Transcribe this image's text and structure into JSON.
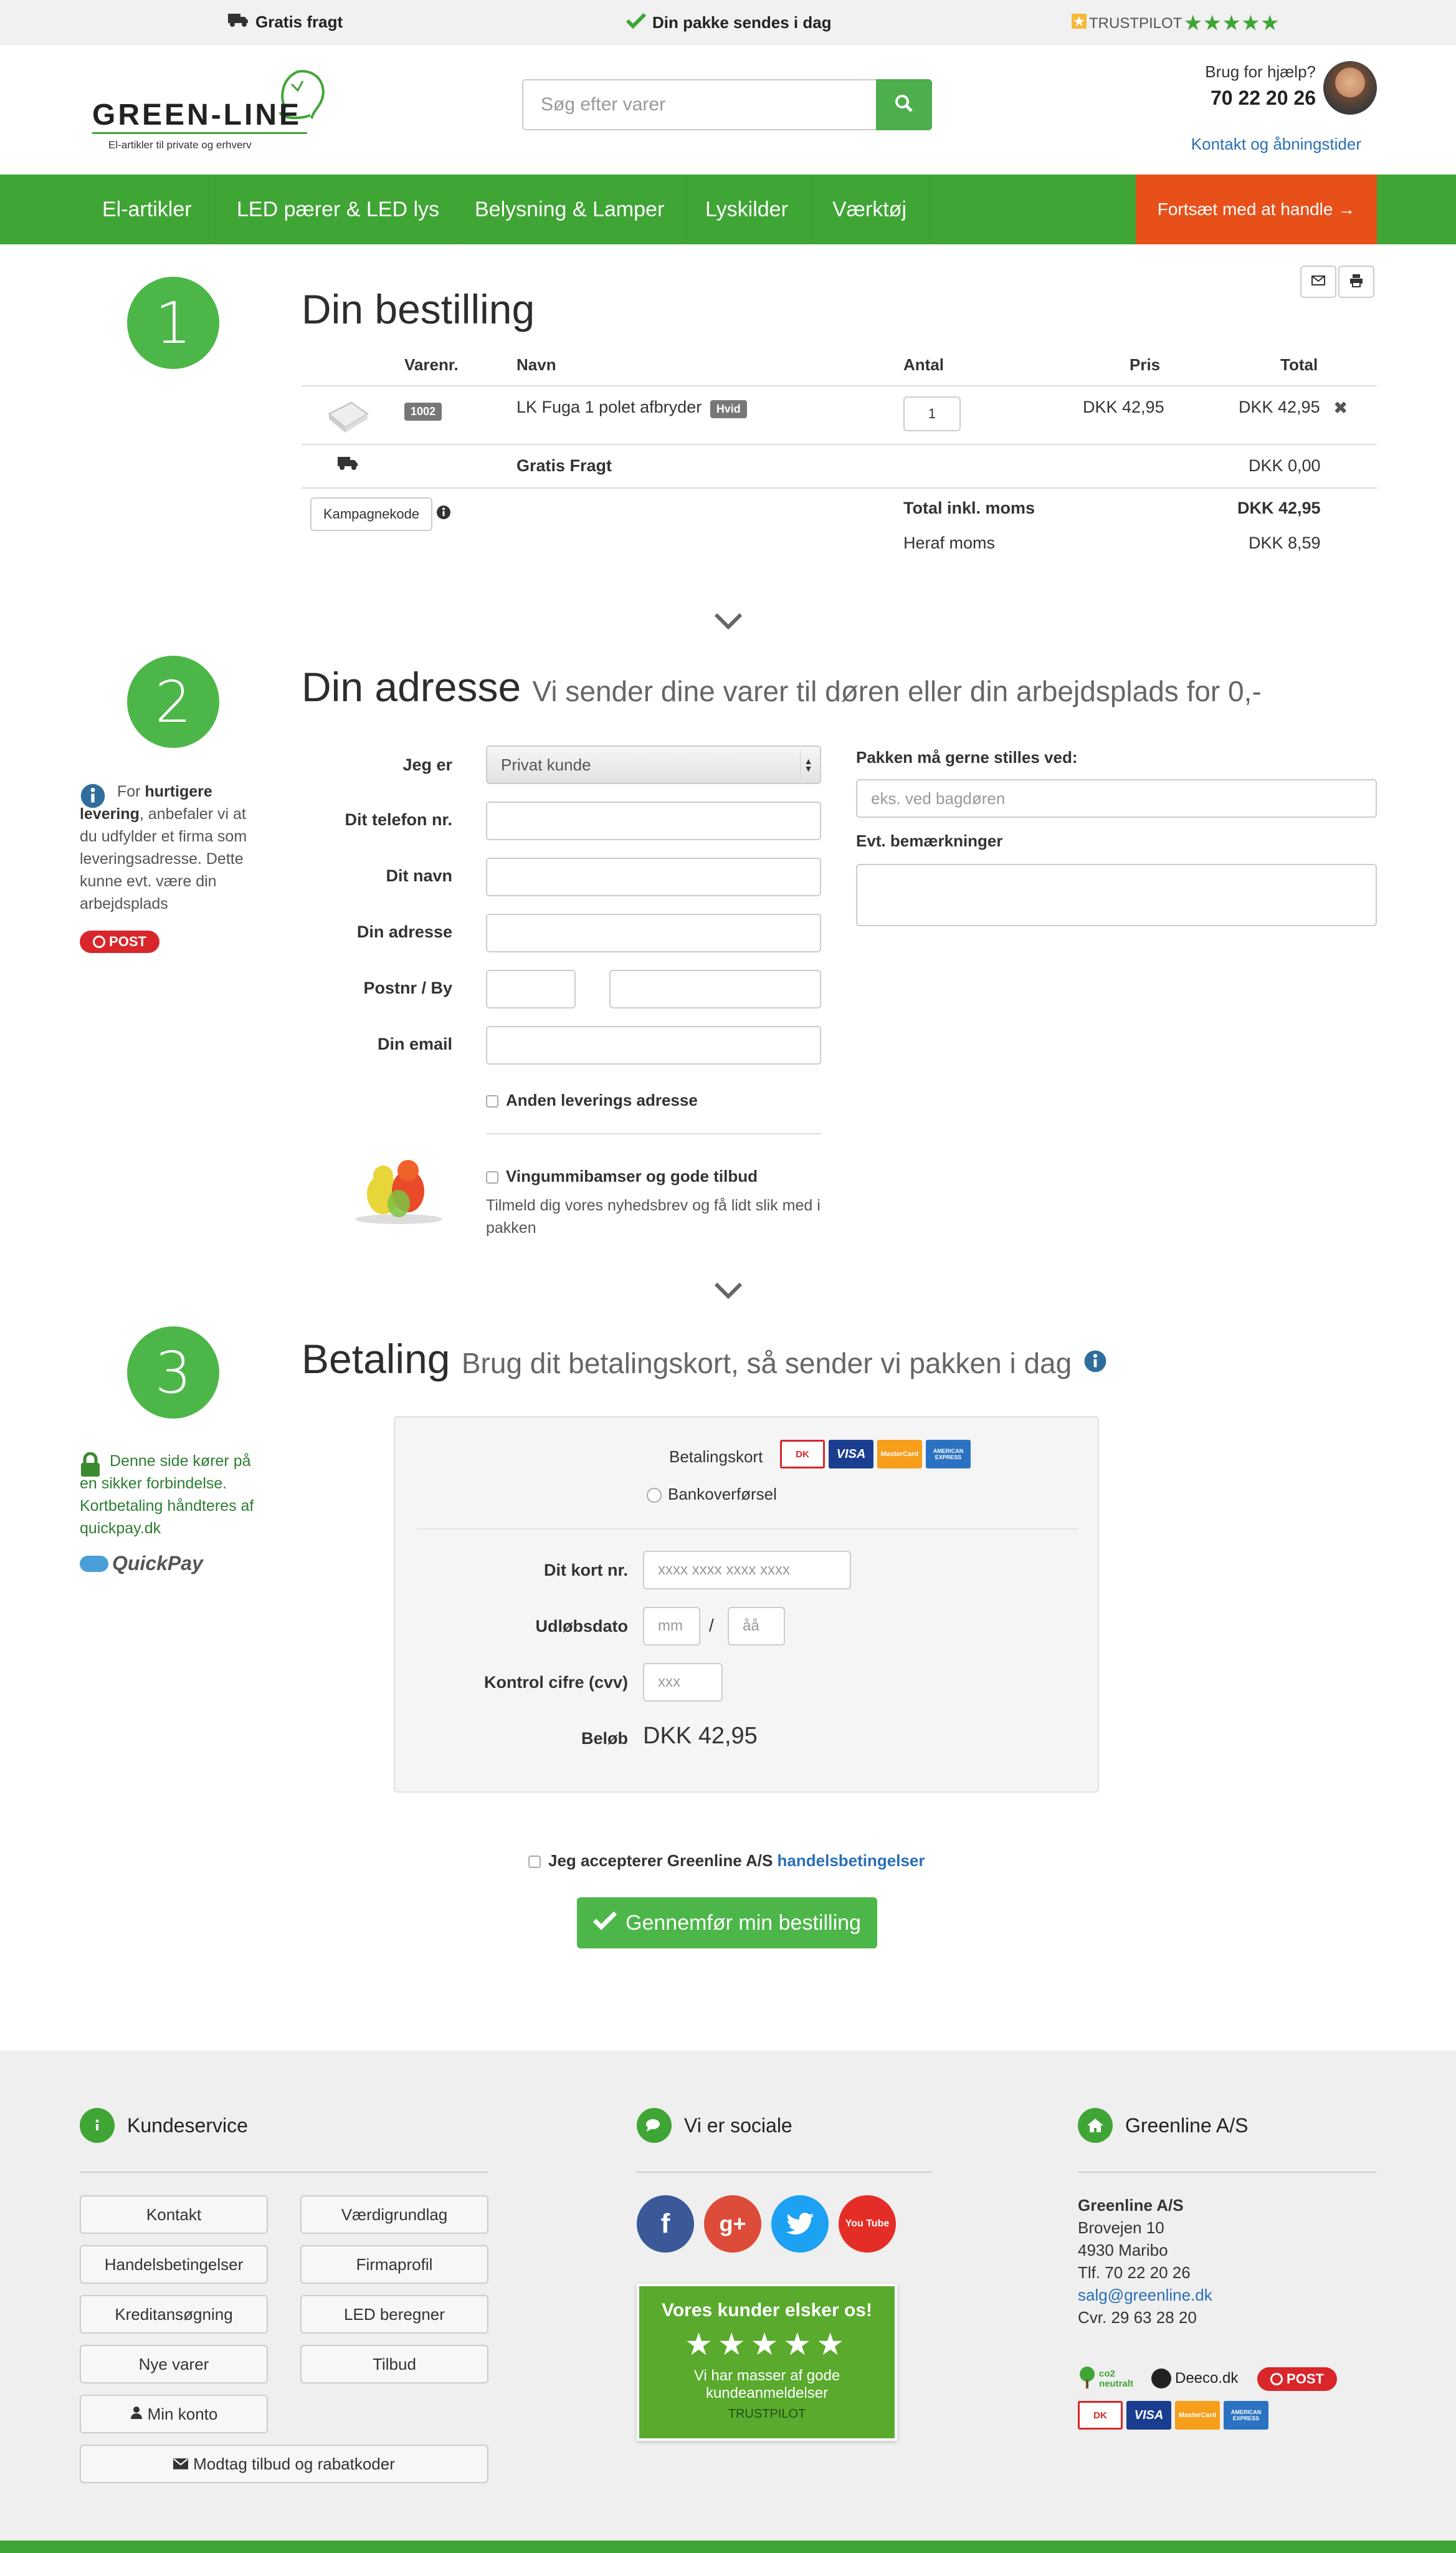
{
  "topbar": {
    "free_shipping": "Gratis fragt",
    "ships_today": "Din pakke sendes i dag",
    "trustpilot": "TRUSTPILOT",
    "stars": "★★★★★"
  },
  "header": {
    "logo_text": "GREEN-LINE",
    "logo_tagline": "El-artikler til private og erhverv",
    "search_placeholder": "Søg efter varer",
    "help_question": "Brug for hjælp?",
    "help_phone": "70 22 20 26",
    "contact_link": "Kontakt og åbningstider"
  },
  "nav": {
    "items": [
      "El-artikler",
      "LED pærer & LED lys",
      "Belysning & Lamper",
      "Lyskilder",
      "Værktøj"
    ],
    "continue_label": "Fortsæt med at handle →"
  },
  "step1": {
    "number": "1",
    "title": "Din bestilling",
    "columns": {
      "varenr": "Varenr.",
      "navn": "Navn",
      "antal": "Antal",
      "pris": "Pris",
      "total": "Total"
    },
    "item": {
      "varenr": "1002",
      "name": "LK Fuga 1 polet afbryder",
      "variant": "Hvid",
      "qty": "1",
      "price": "DKK 42,95",
      "total": "DKK 42,95"
    },
    "shipping_label": "Gratis Fragt",
    "shipping_total": "DKK 0,00",
    "campaign_button": "Kampagnekode",
    "total_label": "Total inkl. moms",
    "total_value": "DKK 42,95",
    "vat_label": "Heraf moms",
    "vat_value": "DKK 8,59"
  },
  "step2": {
    "number": "2",
    "title": "Din adresse",
    "subtitle": "Vi sender dine varer til døren eller din arbejdsplads for 0,-",
    "side_note_pre": "For ",
    "side_note_bold": "hurtigere levering",
    "side_note_post": ", anbefaler vi at du udfylder et firma som leveringsadresse. Dette kunne evt. være din arbejdsplads",
    "post_logo": "POST",
    "labels": {
      "jeg_er": "Jeg er",
      "telefon": "Dit telefon nr.",
      "navn": "Dit navn",
      "adresse": "Din adresse",
      "postnr": "Postnr / By",
      "email": "Din email"
    },
    "customer_type": "Privat kunde",
    "other_address": "Anden leverings adresse",
    "newsletter_title": "Vingummibamser og gode tilbud",
    "newsletter_text": "Tilmeld dig vores nyhedsbrev og få lidt slik med i pakken",
    "place_label": "Pakken må gerne stilles ved:",
    "place_placeholder": "eks. ved bagdøren",
    "remarks_label": "Evt. bemærkninger"
  },
  "step3": {
    "number": "3",
    "title": "Betaling",
    "subtitle": "Brug dit betalingskort, så sender vi pakken i dag",
    "secure_note": "Denne side kører på en sikker forbindelse. Kortbetaling håndteres af quickpay.dk",
    "quickpay": "QuickPay",
    "option_card": "Betalingskort",
    "option_bank": "Bankoverførsel",
    "card_label": "Dit kort nr.",
    "card_placeholder": "xxxx xxxx xxxx xxxx",
    "expiry_label": "Udløbsdato",
    "month_placeholder": "mm",
    "year_placeholder": "åå",
    "cvv_label": "Kontrol cifre (cvv)",
    "cvv_placeholder": "xxx",
    "amount_label": "Beløb",
    "amount_value": "DKK 42,95",
    "accept_text": "Jeg accepterer Greenline A/S ",
    "accept_link": "handelsbetingelser",
    "submit_label": "Gennemfør min bestilling"
  },
  "cards": {
    "dk": "DK",
    "visa": "VISA",
    "mastercard": "MasterCard",
    "amex": "AMERICAN EXPRESS"
  },
  "footer": {
    "service_title": "Kundeservice",
    "service_buttons": [
      "Kontakt",
      "Værdigrundlag",
      "Handelsbetingelser",
      "Firmaprofil",
      "Kreditansøgning",
      "LED beregner",
      "Nye varer",
      "Tilbud",
      "Min konto"
    ],
    "offers_button": "Modtag tilbud og rabatkoder",
    "social_title": "Vi er sociale",
    "social": {
      "facebook": "f",
      "google": "g+",
      "twitter": "t",
      "youtube": "You Tube"
    },
    "tp_title": "Vores kunder elsker os!",
    "tp_stars": "★★★★★",
    "tp_text": "Vi har masser af gode kundeanmeldelser",
    "tp_brand": "TRUSTPILOT",
    "company_title": "Greenline A/S",
    "company_name": "Greenline A/S",
    "company_street": "Brovejen 10",
    "company_city": "4930 Maribo",
    "company_phone": "Tlf. 70 22 20 26",
    "company_email": "salg@greenline.dk",
    "company_cvr": "Cvr. 29 63 28 20",
    "badge_co2": "co2 neutralt",
    "badge_deeco": "Deeco.dk",
    "badge_post": "POST"
  },
  "colors": {
    "green": "#3fa535",
    "orange": "#e8501a",
    "link": "#2a6fb5"
  }
}
